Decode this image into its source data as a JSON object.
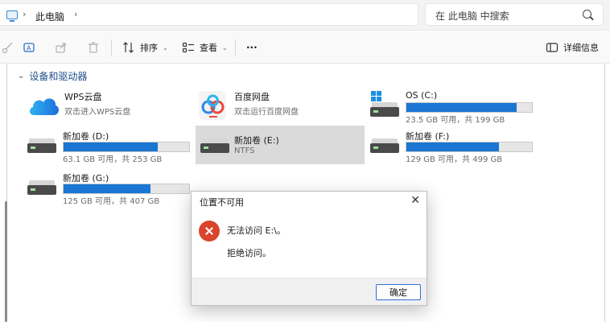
{
  "address_bar": {
    "breadcrumb": "此电脑",
    "separator": "›",
    "search_placeholder": "在 此电脑 中搜索"
  },
  "toolbar": {
    "sort_label": "排序",
    "view_label": "查看",
    "more_label": "···",
    "details_label": "详细信息"
  },
  "section": {
    "title": "设备和驱动器"
  },
  "drives": [
    {
      "name": "WPS云盘",
      "sub": "双击进入WPS云盘"
    },
    {
      "name": "百度网盘",
      "sub": "双击运行百度网盘"
    },
    {
      "name": "OS (C:)",
      "sub": "23.5 GB 可用，共 199 GB",
      "used_fraction": 0.88
    },
    {
      "name": "新加卷 (D:)",
      "sub": "63.1 GB 可用，共 253 GB",
      "used_fraction": 0.75
    },
    {
      "name": "新加卷 (E:)",
      "sub": "NTFS"
    },
    {
      "name": "新加卷 (F:)",
      "sub": "129 GB 可用，共 499 GB",
      "used_fraction": 0.74
    },
    {
      "name": "新加卷 (G:)",
      "sub": "125 GB 可用，共 407 GB",
      "used_fraction": 0.69
    }
  ],
  "dialog": {
    "title": "位置不可用",
    "close": "✕",
    "message": "无法访问 E:\\。",
    "detail": "拒绝访问。",
    "ok_label": "确定"
  },
  "colors": {
    "bar_fill": "#1a76d2",
    "error_red": "#d9452b",
    "selected_tile": "#dadada"
  }
}
